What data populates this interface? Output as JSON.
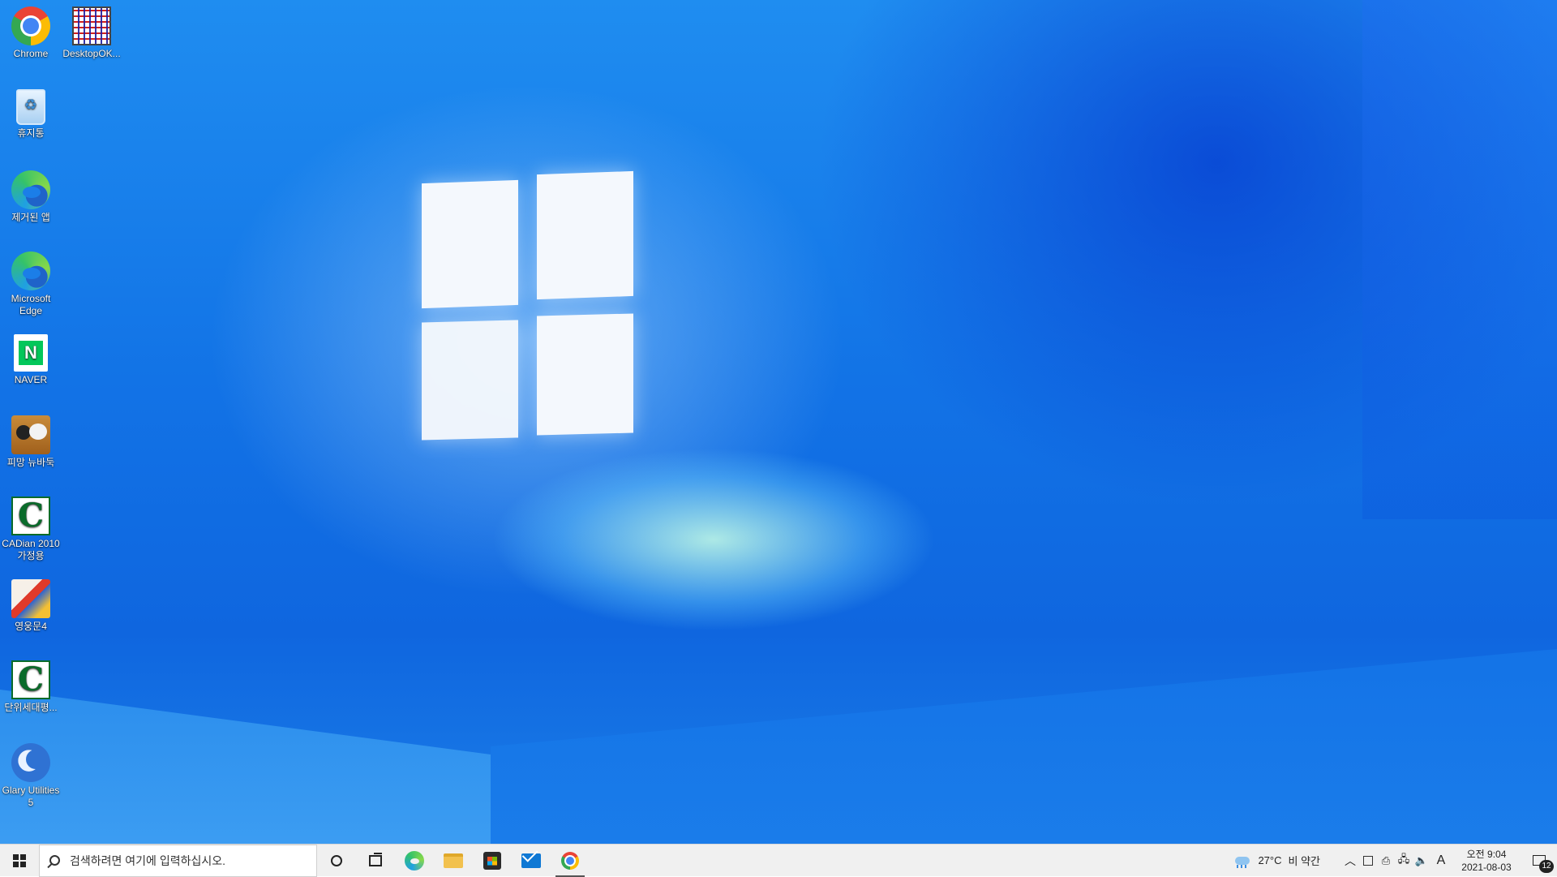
{
  "desktop": {
    "icons": [
      {
        "label": "Chrome",
        "icon": "chrome-icon"
      },
      {
        "label": "DesktopOK...",
        "icon": "desktopok-icon"
      },
      {
        "label": "휴지통",
        "icon": "recycle-bin-icon"
      },
      {
        "label": "제거된 앱",
        "icon": "edge-icon"
      },
      {
        "label": "Microsoft Edge",
        "icon": "edge-icon"
      },
      {
        "label": "NAVER",
        "icon": "naver-icon"
      },
      {
        "label": "피망 뉴바둑",
        "icon": "baduk-icon"
      },
      {
        "label": "CADian 2010 가정용",
        "icon": "cadian-icon"
      },
      {
        "label": "영웅문4",
        "icon": "heroes-icon"
      },
      {
        "label": "단위세대평...",
        "icon": "cadian-icon"
      },
      {
        "label": "Glary Utilities 5",
        "icon": "glary-icon"
      }
    ]
  },
  "taskbar": {
    "search_placeholder": "검색하려면 여기에 입력하십시오.",
    "pinned": [
      "cortana-icon",
      "task-view-icon",
      "edge-icon",
      "file-explorer-icon",
      "store-icon",
      "mail-icon",
      "chrome-icon"
    ],
    "active_app": "chrome-icon"
  },
  "tray": {
    "temperature": "27°C",
    "weather": "비 약간",
    "ime": "A",
    "time": "오전 9:04",
    "date": "2021-08-03",
    "notification_count": "12"
  }
}
